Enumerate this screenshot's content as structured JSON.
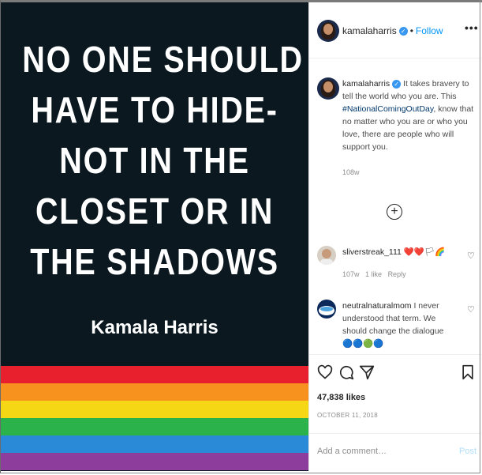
{
  "image": {
    "quote_lines": [
      "NO ONE SHOULD",
      "HAVE TO HIDE-",
      "NOT IN THE",
      "CLOSET OR IN",
      "THE SHADOWS"
    ],
    "author": "Kamala Harris",
    "rainbow_colors": [
      "#e8202e",
      "#f7921e",
      "#f6d716",
      "#2cb24b",
      "#2a8ad8",
      "#8d3d9b"
    ],
    "background_color": "#0b1820"
  },
  "header": {
    "username": "kamalaharris",
    "separator": "•",
    "follow_label": "Follow",
    "more_label": "•••"
  },
  "caption": {
    "username": "kamalaharris",
    "text_before": "It takes bravery to tell the world who you are. This",
    "hashtag": "#NationalComingOutDay",
    "text_after": ", know that no matter who you are or who you love, there are people who will support you.",
    "time": "108w"
  },
  "load_more_label": "+",
  "comments": [
    {
      "username": "sliverstreak_111",
      "text": "❤️❤️🏳🌈",
      "time": "107w",
      "likes": "1 like",
      "reply_label": "Reply"
    },
    {
      "username": "neutralnaturalmom",
      "text": "I never understood that term. We should change the dialogue 🔵🔵🟢🔵",
      "overflow_text": "❤❤❤"
    }
  ],
  "actions": {
    "likes": "47,838 likes",
    "date": "OCTOBER 11, 2018"
  },
  "add_comment": {
    "placeholder": "Add a comment…",
    "post_label": "Post"
  },
  "colors": {
    "link_blue": "#0095f6",
    "hashtag_blue": "#00376b",
    "post_disabled": "#b2dffc"
  }
}
